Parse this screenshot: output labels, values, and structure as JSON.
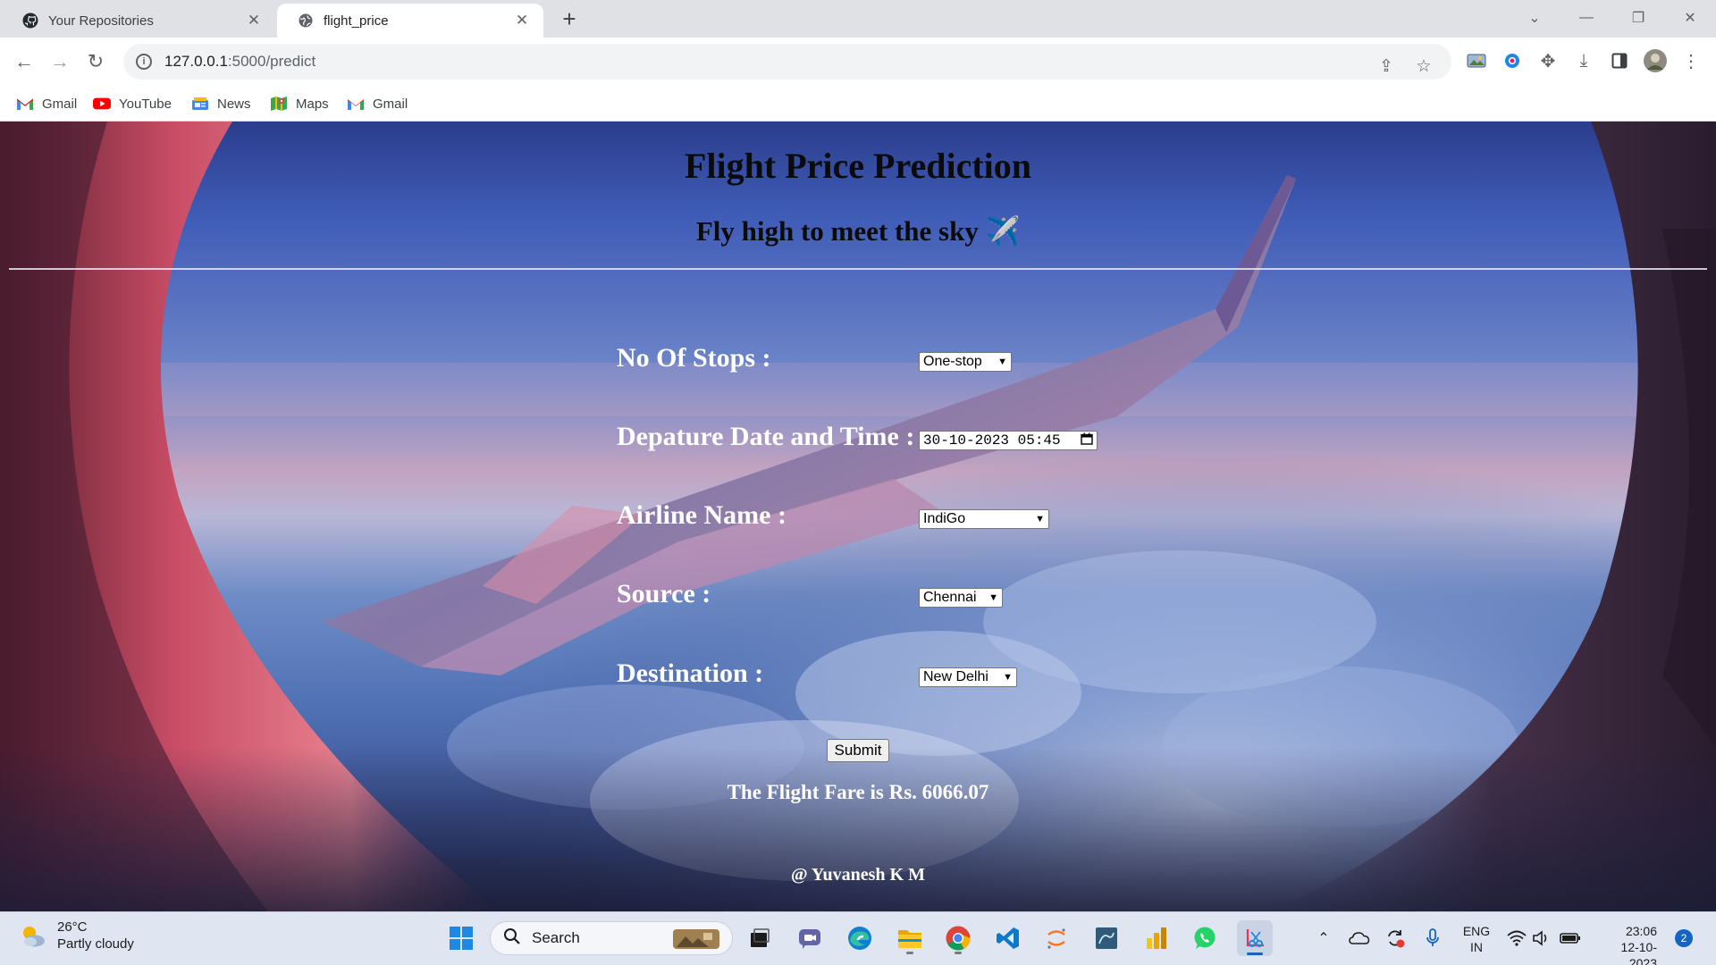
{
  "browser": {
    "tabs": [
      {
        "title": "Your Repositories",
        "icon": "github-icon",
        "active": false
      },
      {
        "title": "flight_price",
        "icon": "globe-icon",
        "active": true
      }
    ],
    "url_host": "127.0.0.1",
    "url_path": ":5000/predict",
    "bookmarks": [
      {
        "label": "Gmail",
        "icon": "gmail-icon"
      },
      {
        "label": "YouTube",
        "icon": "youtube-icon"
      },
      {
        "label": "News",
        "icon": "news-icon"
      },
      {
        "label": "Maps",
        "icon": "maps-icon"
      },
      {
        "label": "Gmail",
        "icon": "gmail-icon"
      }
    ]
  },
  "page": {
    "title": "Flight Price Prediction",
    "subtitle": "Fly high to meet the sky ✈️",
    "form": {
      "stops": {
        "label": "No Of Stops :",
        "value": "One-stop"
      },
      "departure": {
        "label": "Depature Date and Time :",
        "value": "30-10-2023 05:45"
      },
      "airline": {
        "label": "Airline Name :",
        "value": "IndiGo"
      },
      "source": {
        "label": "Source :",
        "value": "Chennai"
      },
      "destination": {
        "label": "Destination :",
        "value": "New Delhi"
      },
      "submit_label": "Submit"
    },
    "result": "The Flight Fare is Rs. 6066.07",
    "footer": "@ Yuvanesh K M"
  },
  "taskbar": {
    "weather_temp": "26°C",
    "weather_desc": "Partly cloudy",
    "search_label": "Search",
    "lang_line1": "ENG",
    "lang_line2": "IN",
    "time": "23:06",
    "date": "12-10-2023",
    "notification_count": "2"
  },
  "colors": {
    "sky_top": "#2b3d8c",
    "sky_horizon": "#c2a3c0",
    "window_frame_pink": "#d9667a",
    "wing": "#8a7aa8",
    "accent_blue": "#1565c0"
  }
}
